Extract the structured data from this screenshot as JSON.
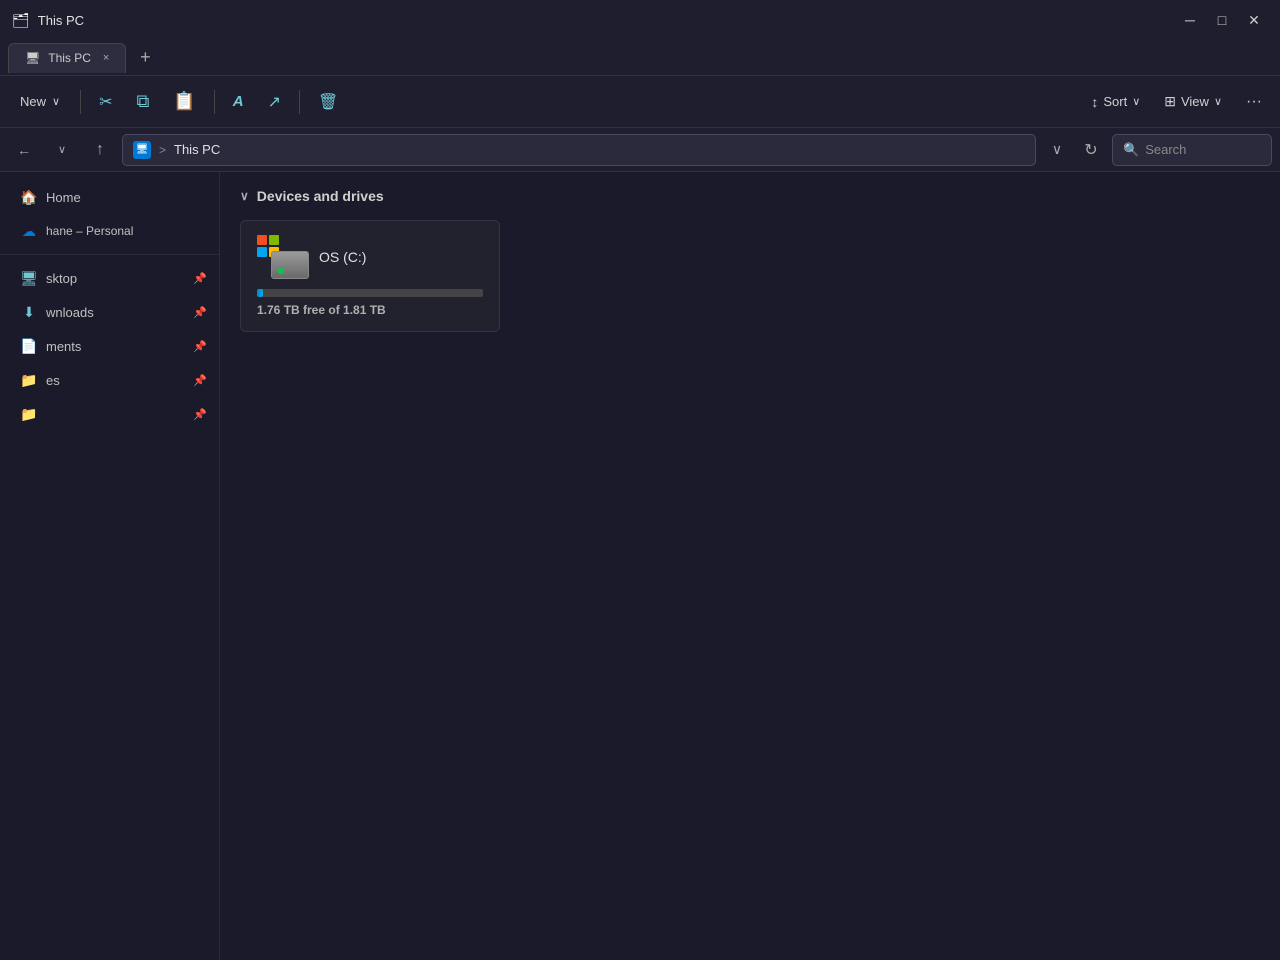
{
  "window": {
    "title": "This PC",
    "tab_label": "This PC",
    "tab_close": "×",
    "tab_new": "+"
  },
  "toolbar": {
    "new_label": "New",
    "new_chevron": "∨",
    "cut_icon": "✂",
    "copy_icon": "⧉",
    "paste_icon": "⬛",
    "rename_icon": "A",
    "share_icon": "↗",
    "delete_icon": "🗑",
    "sort_label": "Sort",
    "view_label": "View",
    "more_label": "···"
  },
  "address_bar": {
    "pc_icon": "🖥",
    "separator": ">",
    "path": "This PC",
    "chevron": "∨",
    "refresh": "↻",
    "search_placeholder": "Search"
  },
  "navigation": {
    "back_icon": "→",
    "history_icon": "∨",
    "up_icon": "↑"
  },
  "sidebar": {
    "home_label": "Home",
    "personal_label": "hane – Personal",
    "divider": true,
    "pinned_items": [
      {
        "label": "sktop",
        "icon": "📁",
        "pinned": true
      },
      {
        "label": "wnloads",
        "icon": "📁",
        "pinned": true
      },
      {
        "label": "ments",
        "icon": "📁",
        "pinned": true
      },
      {
        "label": "es",
        "icon": "📁",
        "pinned": true
      }
    ],
    "pin_icon": "📌"
  },
  "content": {
    "section_label": "Devices and drives",
    "section_chevron": "∨",
    "drives": [
      {
        "label": "OS (C:)",
        "free": "1.76 TB",
        "total": "1.81 TB",
        "free_text": "1.76 TB free of 1.81 TB",
        "used_percent": 2.8
      }
    ]
  },
  "colors": {
    "accent": "#00aaee",
    "toolbar_bg": "#1e1e2e",
    "sidebar_bg": "#1a1a2a",
    "content_bg": "#1a1a2a",
    "drive_bg": "#22222e",
    "text_primary": "#e0e0e0",
    "text_secondary": "#b0b0b0",
    "icon_cyan": "#70c8d4"
  }
}
